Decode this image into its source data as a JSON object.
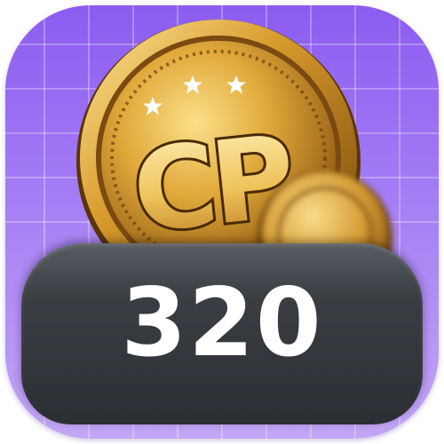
{
  "coin": {
    "monogram": "CP",
    "star_count": 3,
    "colors": {
      "gold_light": "#f6d36a",
      "gold_mid": "#d49a2a",
      "gold_dark": "#7a4a10",
      "rim_dark": "#5a3608"
    }
  },
  "badge": {
    "value": "320"
  },
  "colors": {
    "background_top": "#8c5cf0",
    "background_bottom": "#c3a6f5",
    "badge": "#2b2e33",
    "badge_text": "#ffffff"
  },
  "icons": {
    "star": "star-icon",
    "coin": "cp-coin-icon"
  }
}
